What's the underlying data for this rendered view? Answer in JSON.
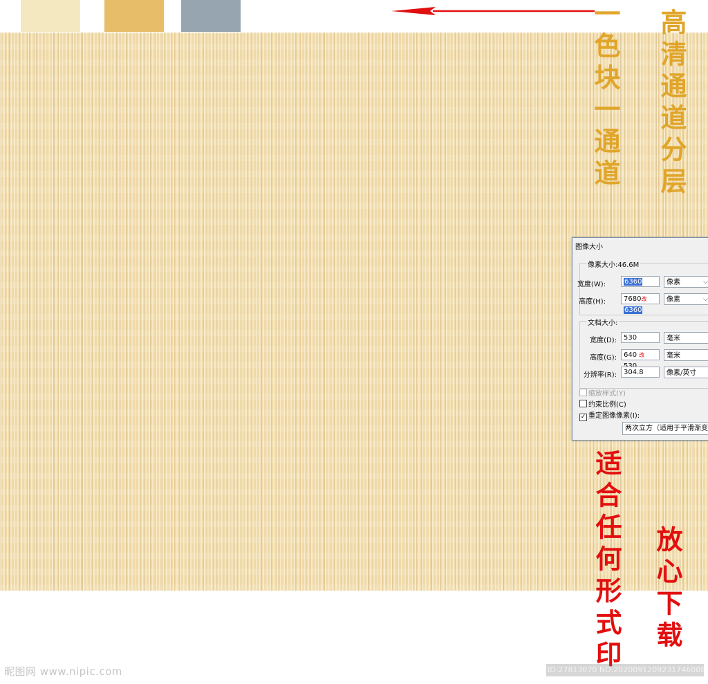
{
  "swatches": [
    {
      "name": "swatch-cream",
      "color": "#f4e8c0"
    },
    {
      "name": "swatch-gold",
      "color": "#e8bd6a"
    },
    {
      "name": "swatch-gray",
      "color": "#97a5b0"
    }
  ],
  "colors": {
    "texture_base": "#efd9a8",
    "gold_text": "#e0a52a",
    "red_text": "#e20f0f",
    "arrow": "#e20f0f"
  },
  "annotations": {
    "left_gold": "一色块一通道",
    "right_gold": "高清通道分层",
    "red_left": "适合任何形式印",
    "red_right": "放心下载"
  },
  "dialog": {
    "title": "图像大小",
    "pixel_group_label": "像素大小:46.6M",
    "width_label": "宽度(W):",
    "width_value": "6360",
    "width_unit": "像素",
    "height_label": "高度(H):",
    "height_value_old": "7680",
    "height_change_mark": "改",
    "height_value_new": "6360",
    "height_unit": "像素",
    "doc_group_label": "文档大小:",
    "doc_width_label": "宽度(D):",
    "doc_width_value": "530",
    "doc_width_unit": "毫米",
    "doc_height_label": "高度(G):",
    "doc_height_old": "640",
    "doc_height_mark": "改",
    "doc_height_new": "530",
    "doc_height_unit": "毫米",
    "resolution_label": "分辨率(R):",
    "resolution_value": "304.8",
    "resolution_unit": "像素/英寸",
    "scale_styles": "缩放样式(Y)",
    "constrain": "约束比例(C)",
    "resample": "重定图像像素(I):",
    "resample_method": "两次立方（适用于平滑渐变"
  },
  "watermarks": {
    "left": "昵图网 www.nipic.com",
    "right": "ID:27813070 NO:20200912092317460083"
  }
}
